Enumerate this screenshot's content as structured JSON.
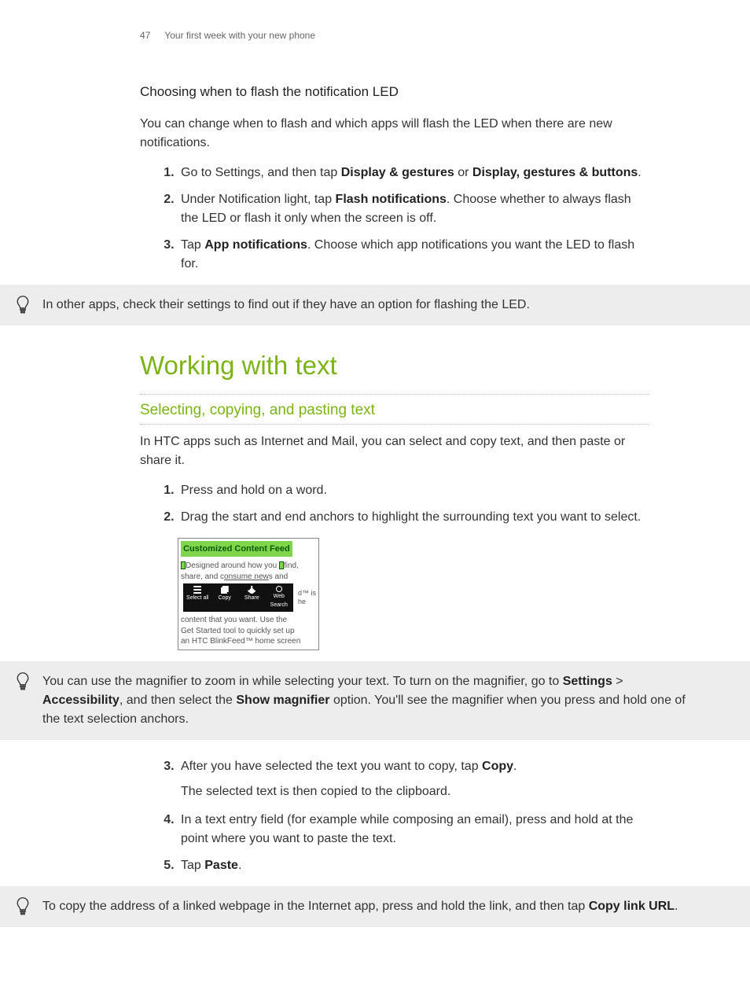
{
  "header": {
    "page_number": "47",
    "chapter": "Your first week with your new phone"
  },
  "section_led": {
    "heading": "Choosing when to flash the notification LED",
    "intro": "You can change when to flash and which apps will flash the LED when there are new notifications.",
    "steps": {
      "s1_a": "Go to Settings, and then tap ",
      "s1_b1": "Display & gestures",
      "s1_c": " or ",
      "s1_b2": "Display, gestures & buttons",
      "s1_d": ".",
      "s2_a": "Under Notification light, tap ",
      "s2_b": "Flash notifications",
      "s2_c": ". Choose whether to always flash the LED or flash it only when the screen is off.",
      "s3_a": "Tap ",
      "s3_b": "App notifications",
      "s3_c": ". Choose which app notifications you want the LED to flash for."
    },
    "tip": "In other apps, check their settings to find out if they have an option for flashing the LED."
  },
  "section_text": {
    "title": "Working with text",
    "subtitle": "Selecting, copying, and pasting text",
    "intro": "In HTC apps such as Internet and Mail, you can select and copy text, and then paste or share it.",
    "steps_a": {
      "s1": "Press and hold on a word.",
      "s2": "Drag the start and end anchors to highlight the surrounding text you want to select."
    },
    "screenshot": {
      "highlight": "Customized Content Feed",
      "l1": "Designed around how you",
      "l1b": "find,",
      "l2a": "share, and c",
      "l2u": "onsume new",
      "l2b": "s and",
      "tb_selectall": "Select all",
      "tb_copy": "Copy",
      "tb_share": "Share",
      "tb_web": "Web Search",
      "l3b": "d™ is",
      "l3c": "he",
      "l4": "content that you want. Use the",
      "l5": "Get Started tool to quickly set up",
      "l6": "an HTC BlinkFeed™ home screen"
    },
    "tip_magnifier": {
      "a": "You can use the magnifier to zoom in while selecting your text. To turn on the magnifier, go to ",
      "b1": "Settings",
      "c": " > ",
      "b2": "Accessibility",
      "d": ", and then select the ",
      "b3": "Show magnifier",
      "e": " option. You'll see the magnifier when you press and hold one of the text selection anchors."
    },
    "steps_b": {
      "s3_a": "After you have selected the text you want to copy, tap ",
      "s3_b": "Copy",
      "s3_c": ".",
      "s3_sub": "The selected text is then copied to the clipboard.",
      "s4": "In a text entry field (for example while composing an email), press and hold at the point where you want to paste the text.",
      "s5_a": "Tap ",
      "s5_b": "Paste",
      "s5_c": "."
    },
    "tip_copylink": {
      "a": "To copy the address of a linked webpage in the Internet app, press and hold the link, and then tap ",
      "b": "Copy link URL",
      "c": "."
    }
  }
}
